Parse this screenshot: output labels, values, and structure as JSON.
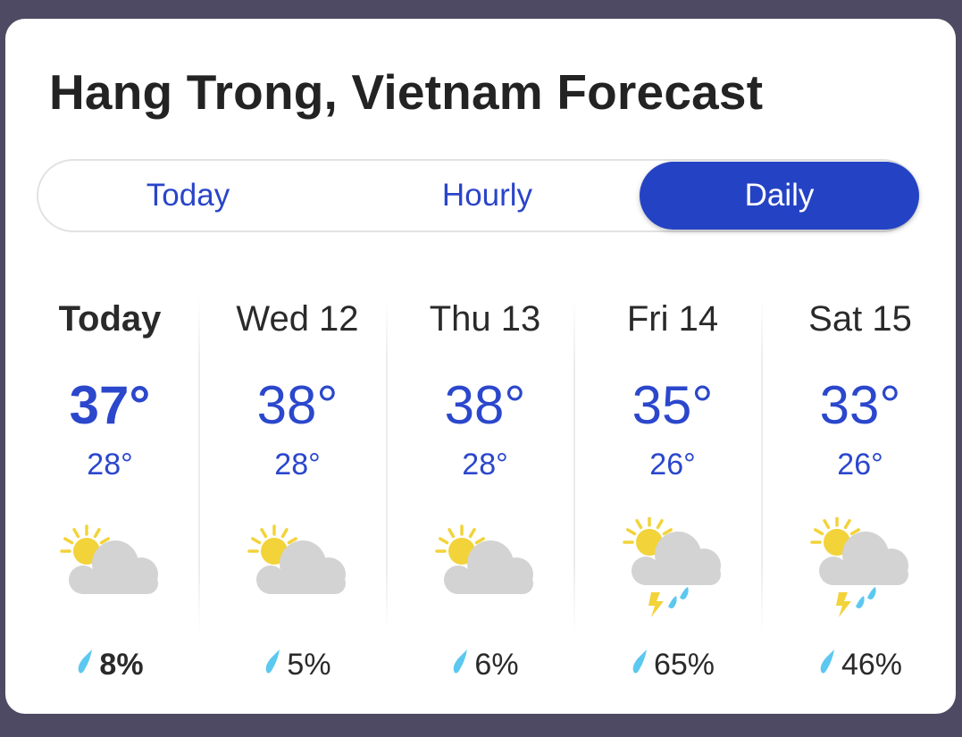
{
  "title": "Hang Trong, Vietnam Forecast",
  "tabs": {
    "today": "Today",
    "hourly": "Hourly",
    "daily": "Daily",
    "selected": "daily"
  },
  "colors": {
    "accent": "#2443c4",
    "temp": "#2b47cc",
    "sun": "#f2d33a",
    "cloud": "#d3d3d3",
    "drop": "#5cc8f0"
  },
  "days": [
    {
      "label": "Today",
      "high": "37°",
      "low": "28°",
      "icon": "partly-cloudy-icon",
      "precip": "8%"
    },
    {
      "label": "Wed 12",
      "high": "38°",
      "low": "28°",
      "icon": "partly-cloudy-icon",
      "precip": "5%"
    },
    {
      "label": "Thu 13",
      "high": "38°",
      "low": "28°",
      "icon": "partly-cloudy-icon",
      "precip": "6%"
    },
    {
      "label": "Fri 14",
      "high": "35°",
      "low": "26°",
      "icon": "thunderstorm-icon",
      "precip": "65%"
    },
    {
      "label": "Sat 15",
      "high": "33°",
      "low": "26°",
      "icon": "thunderstorm-icon",
      "precip": "46%"
    }
  ]
}
